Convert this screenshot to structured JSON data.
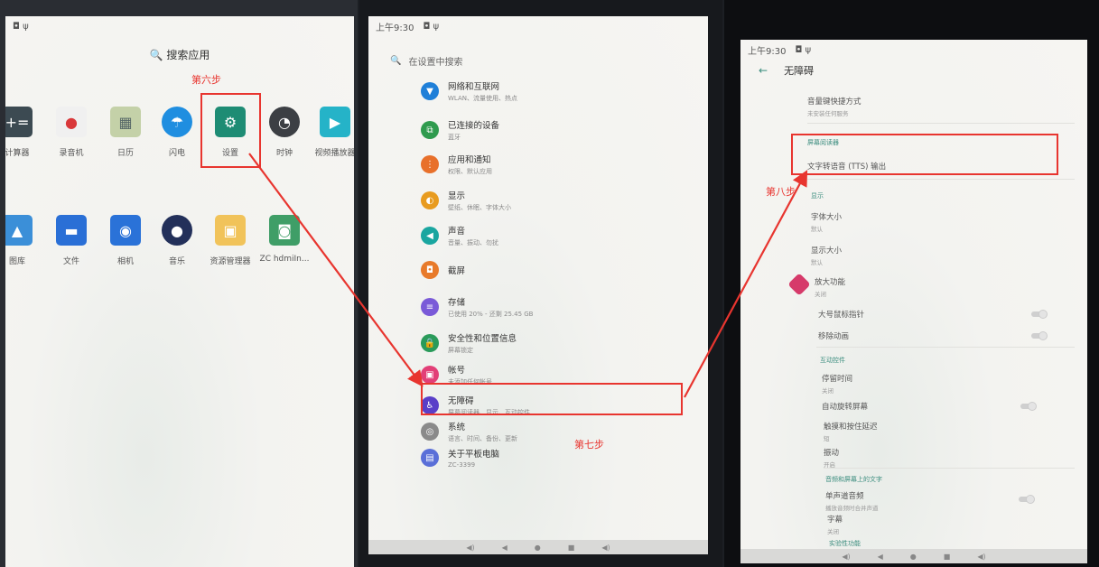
{
  "panel1": {
    "search_label": "搜索应用",
    "status_icons": "◘ ψ",
    "step_label": "第六步",
    "row1": [
      {
        "label": "计算器",
        "icon": "calculator-icon",
        "color": "#3c4a52",
        "glyph": "+="
      },
      {
        "label": "录音机",
        "icon": "recorder-icon",
        "color": "#f0f0f0",
        "glyph": "🎙"
      },
      {
        "label": "日历",
        "icon": "calendar-icon",
        "color": "#c4d1a8",
        "glyph": "▦"
      },
      {
        "label": "闪电",
        "icon": "flash-icon",
        "color": "#1f8ee0",
        "glyph": "☂"
      },
      {
        "label": "设置",
        "icon": "settings-gear-icon",
        "color": "#1e8c74",
        "glyph": "⚙"
      },
      {
        "label": "时钟",
        "icon": "clock-icon",
        "color": "#3c3f44",
        "glyph": "◔"
      },
      {
        "label": "视频播放器",
        "icon": "video-player-icon",
        "color": "#25b3c8",
        "glyph": "▶"
      }
    ],
    "row2": [
      {
        "label": "图库",
        "icon": "gallery-icon",
        "color": "#3b8fd8",
        "glyph": "▲"
      },
      {
        "label": "文件",
        "icon": "files-icon",
        "color": "#2a6fd6",
        "glyph": "▬"
      },
      {
        "label": "相机",
        "icon": "camera-icon",
        "color": "#2a72d8",
        "glyph": "◉"
      },
      {
        "label": "音乐",
        "icon": "music-icon",
        "color": "#23305a",
        "glyph": "●"
      },
      {
        "label": "资源管理器",
        "icon": "file-explorer-icon",
        "color": "#f1c35a",
        "glyph": "▣"
      },
      {
        "label": "ZC hdmiIn...",
        "icon": "android-icon",
        "color": "#3f9e67",
        "glyph": "◙"
      }
    ]
  },
  "panel2": {
    "time": "上午9:30",
    "status_icons": "◘ ψ",
    "search_placeholder": "在设置中搜索",
    "step_label": "第七步",
    "items": [
      {
        "title": "网络和互联网",
        "sub": "WLAN、流量使用、热点",
        "icon": "wifi-icon",
        "color": "#1f7fd8",
        "glyph": "▼"
      },
      {
        "title": "已连接的设备",
        "sub": "蓝牙",
        "icon": "devices-icon",
        "color": "#2f9b4e",
        "glyph": "⧉"
      },
      {
        "title": "应用和通知",
        "sub": "权限、默认应用",
        "icon": "apps-icon",
        "color": "#e8702a",
        "glyph": "⋮"
      },
      {
        "title": "显示",
        "sub": "壁纸、休眠、字体大小",
        "icon": "display-icon",
        "color": "#e89b1f",
        "glyph": "◐"
      },
      {
        "title": "声音",
        "sub": "音量、振动、勿扰",
        "icon": "sound-icon",
        "color": "#1aa6a0",
        "glyph": "◀"
      },
      {
        "title": "截屏",
        "sub": "",
        "icon": "screenshot-icon",
        "color": "#e87a2a",
        "glyph": "◘"
      },
      {
        "title": "存储",
        "sub": "已使用 20% - 还剩 25.45 GB",
        "icon": "storage-icon",
        "color": "#7a5ad8",
        "glyph": "≡"
      },
      {
        "title": "安全性和位置信息",
        "sub": "屏幕锁定",
        "icon": "security-lock-icon",
        "color": "#2a9b5a",
        "glyph": "🔒"
      },
      {
        "title": "帐号",
        "sub": "未添加任何帐号",
        "icon": "account-icon",
        "color": "#e23f77",
        "glyph": "▣"
      },
      {
        "title": "无障碍",
        "sub": "屏幕阅读器、显示、互动控件",
        "icon": "accessibility-icon",
        "color": "#5a3fc8",
        "glyph": "♿"
      },
      {
        "title": "系统",
        "sub": "语言、时间、备份、更新",
        "icon": "system-icon",
        "color": "#8a8a8a",
        "glyph": "◎"
      },
      {
        "title": "关于平板电脑",
        "sub": "ZC-3399",
        "icon": "about-tablet-icon",
        "color": "#5a6fd8",
        "glyph": "▤"
      }
    ],
    "nav": [
      "◀)",
      "◀",
      "●",
      "■",
      "◀)"
    ]
  },
  "panel3": {
    "time": "上午9:30",
    "status_icons": "◘ ψ",
    "title": "无障碍",
    "step_label": "第八步",
    "shortcut": {
      "title": "音量键快捷方式",
      "sub": "未安装任何服务"
    },
    "screen_reader_header": "屏幕阅读器",
    "tts": "文字转语音 (TTS) 输出",
    "display_header": "显示",
    "font_size": {
      "title": "字体大小",
      "sub": "默认"
    },
    "display_size": {
      "title": "显示大小",
      "sub": "默认"
    },
    "magnify": {
      "title": "放大功能",
      "sub": "关闭"
    },
    "large_pointer": "大号鼠标指针",
    "remove_anim": "移除动画",
    "interaction_header": "互动控件",
    "dwell": {
      "title": "停留时间",
      "sub": "关闭"
    },
    "auto_rotate": "自动旋转屏幕",
    "touch_delay": {
      "title": "触摸和按住延迟",
      "sub": "短"
    },
    "vibration": {
      "title": "振动",
      "sub": "开启"
    },
    "audio_header": "音频和屏幕上的文字",
    "mono_audio": {
      "title": "单声道音频",
      "sub": "播放音频时合并声道"
    },
    "captions": {
      "title": "字幕",
      "sub": "关闭"
    },
    "experimental_header": "实验性功能",
    "nav": [
      "◀)",
      "◀",
      "●",
      "■",
      "◀)"
    ]
  },
  "colors": {
    "annotation": "#e8352f",
    "accent": "#3b8d7e"
  }
}
